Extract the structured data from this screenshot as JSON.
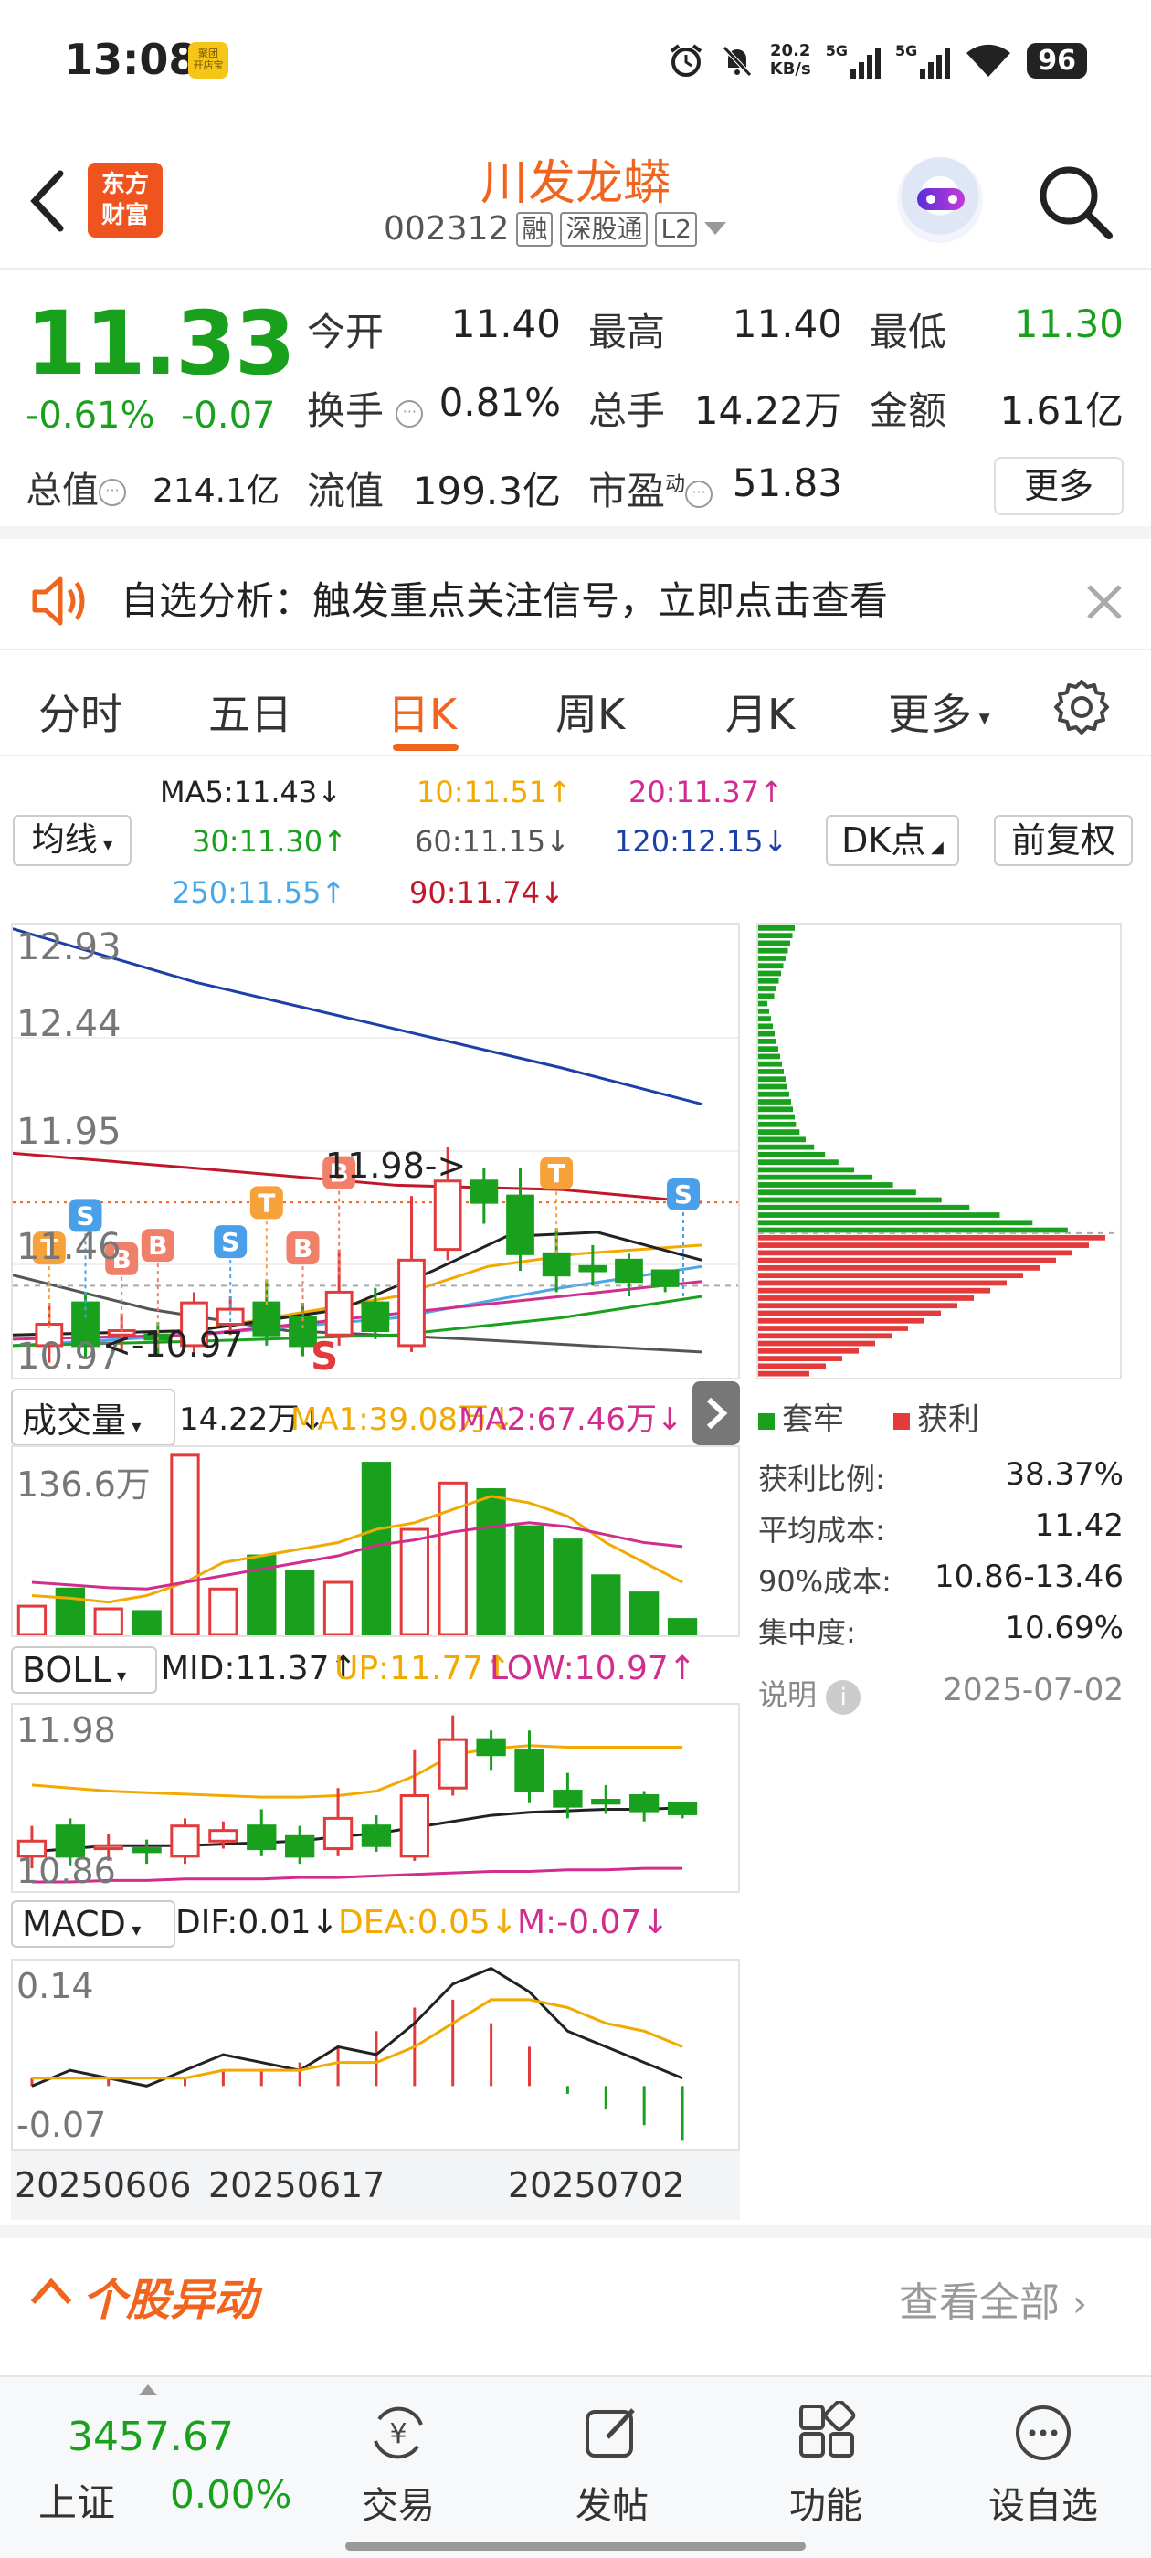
{
  "status_bar": {
    "time": "13:08",
    "notif_badge": "聚团\n开店宝",
    "net_speed": "20.2",
    "net_unit": "KB/s",
    "sig1": "5G",
    "sig2": "5G",
    "battery": "96"
  },
  "header": {
    "logo_line1": "东方",
    "logo_line2": "财富",
    "stock_name": "川发龙蟒",
    "stock_code": "002312",
    "tag_margin": "融",
    "tag_connect": "深股通",
    "tag_level": "L2"
  },
  "quote": {
    "price": "11.33",
    "change_pct": "-0.61%",
    "change_abs": "-0.07",
    "open_label": "今开",
    "open": "11.40",
    "high_label": "最高",
    "high": "11.40",
    "low_label": "最低",
    "low": "11.30",
    "turnover_label": "换手",
    "turnover": "0.81%",
    "volume_label": "总手",
    "volume": "14.22万",
    "amount_label": "金额",
    "amount": "1.61亿",
    "mktcap_label": "总值",
    "mktcap": "214.1亿",
    "float_label": "流值",
    "float": "199.3亿",
    "pe_label": "市盈",
    "pe_sup": "动",
    "pe": "51.83",
    "more_label": "更多"
  },
  "notice": {
    "text": "自选分析：触发重点关注信号，立即点击查看"
  },
  "tabs": [
    "分时",
    "五日",
    "日K",
    "周K",
    "月K",
    "更多"
  ],
  "ma_legend": {
    "selector": "均线",
    "ma5": "MA5:11.43↓",
    "ma10": "10:11.51↑",
    "ma20": "20:11.37↑",
    "ma30": "30:11.30↑",
    "ma60": "60:11.15↓",
    "ma120": "120:12.15↓",
    "ma250": "250:11.55↑",
    "ma90": "90:11.74↓",
    "dk_btn": "DK点",
    "adj_btn": "前复权",
    "colors": {
      "ma5": "#222222",
      "ma10": "#f2a900",
      "ma20": "#d12d8e",
      "ma30": "#19a11e",
      "ma60": "#555555",
      "ma120": "#1d3fa8",
      "ma250": "#4aa8e8",
      "ma90": "#c0182a"
    }
  },
  "kline": {
    "y_labels": [
      "12.93",
      "12.44",
      "11.95",
      "11.46",
      "10.97"
    ],
    "high_marker": "11.98->",
    "low_marker": "<-10.97",
    "signal_s": "S",
    "candles": [
      {
        "o": 11.05,
        "c": 11.15,
        "h": 11.25,
        "l": 10.97
      },
      {
        "o": 11.25,
        "c": 11.05,
        "h": 11.3,
        "l": 10.99
      },
      {
        "o": 11.1,
        "c": 11.12,
        "h": 11.2,
        "l": 11.02
      },
      {
        "o": 11.1,
        "c": 11.08,
        "h": 11.16,
        "l": 11.0
      },
      {
        "o": 11.05,
        "c": 11.25,
        "h": 11.3,
        "l": 11.0
      },
      {
        "o": 11.15,
        "c": 11.22,
        "h": 11.28,
        "l": 11.1
      },
      {
        "o": 11.25,
        "c": 11.1,
        "h": 11.36,
        "l": 11.05
      },
      {
        "o": 11.18,
        "c": 11.05,
        "h": 11.25,
        "l": 11.0
      },
      {
        "o": 11.1,
        "c": 11.3,
        "h": 11.5,
        "l": 11.05
      },
      {
        "o": 11.25,
        "c": 11.12,
        "h": 11.32,
        "l": 11.08
      },
      {
        "o": 11.05,
        "c": 11.45,
        "h": 11.75,
        "l": 11.02
      },
      {
        "o": 11.5,
        "c": 11.82,
        "h": 11.98,
        "l": 11.45
      },
      {
        "o": 11.82,
        "c": 11.72,
        "h": 11.88,
        "l": 11.62
      },
      {
        "o": 11.75,
        "c": 11.48,
        "h": 11.88,
        "l": 11.4
      },
      {
        "o": 11.48,
        "c": 11.38,
        "h": 11.6,
        "l": 11.3
      },
      {
        "o": 11.42,
        "c": 11.4,
        "h": 11.52,
        "l": 11.33
      },
      {
        "o": 11.45,
        "c": 11.35,
        "h": 11.48,
        "l": 11.28
      },
      {
        "o": 11.4,
        "c": 11.33,
        "h": 11.4,
        "l": 11.3
      }
    ],
    "signals": [
      {
        "i": 0,
        "t": "T",
        "kind": "sell"
      },
      {
        "i": 1,
        "t": "S",
        "kind": "sell-blue"
      },
      {
        "i": 2,
        "t": "B",
        "kind": "buy"
      },
      {
        "i": 3,
        "t": "B",
        "kind": "buy"
      },
      {
        "i": 5,
        "t": "S",
        "kind": "sell-blue"
      },
      {
        "i": 6,
        "t": "T",
        "kind": "sell"
      },
      {
        "i": 7,
        "t": "B",
        "kind": "buy"
      },
      {
        "i": 8,
        "t": "B",
        "kind": "buy"
      },
      {
        "i": 14,
        "t": "T",
        "kind": "sell"
      },
      {
        "i": 18,
        "t": "S",
        "kind": "sell-blue"
      }
    ]
  },
  "chips": {
    "legend_trapped": "套牢",
    "legend_profit": "获利",
    "profit_ratio_label": "获利比例:",
    "profit_ratio": "38.37%",
    "avg_cost_label": "平均成本:",
    "avg_cost": "11.42",
    "cost90_label": "90%成本:",
    "cost90": "10.86-13.46",
    "concentration_label": "集中度:",
    "concentration": "10.69%",
    "note_label": "说明",
    "date": "2025-07-02"
  },
  "volume": {
    "selector": "成交量",
    "vol": "14.22万↓",
    "ma1": "MA1:39.08万↓",
    "ma2": "MA2:67.46万↓",
    "y_label": "136.6万",
    "bars": [
      22,
      35,
      20,
      18,
      136,
      35,
      60,
      48,
      40,
      130,
      80,
      115,
      110,
      82,
      72,
      45,
      32,
      12
    ]
  },
  "boll": {
    "selector": "BOLL",
    "mid": "MID:11.37↑",
    "up": "UP:11.77↑",
    "low": "LOW:10.97↑",
    "y_high": "11.98",
    "y_low": "10.86"
  },
  "macd": {
    "selector": "MACD",
    "dif": "DIF:0.01↓",
    "dea": "DEA:0.05↓",
    "m": "M:-0.07↓",
    "y_high": "0.14",
    "y_low": "-0.07",
    "dates": [
      "20250606",
      "20250617",
      "20250702"
    ]
  },
  "abnormal": {
    "title": "个股异动",
    "view_all": "查看全部"
  },
  "bottom_nav": {
    "index_value": "3457.67",
    "index_name": "上证",
    "index_change": "0.00%",
    "trade": "交易",
    "post": "发帖",
    "func": "功能",
    "watch": "设自选"
  }
}
